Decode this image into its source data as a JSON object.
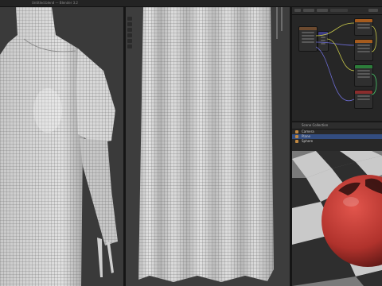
{
  "app": {
    "window_title": "Untitled.blend — Blender 3.2"
  },
  "viewports": {
    "left": {
      "object": "dress-body-mesh"
    },
    "middle": {
      "object": "curtain-mesh"
    }
  },
  "outliner": {
    "header_label": "Scene Collection",
    "items": [
      "Camera",
      "Plane",
      "Sphere"
    ]
  },
  "colors": {
    "viewport_bg": "#3a3a3a",
    "mesh_light": "#d2d2d2",
    "wire": "#5a5a5a",
    "sphere_red": "#b0322c",
    "checker_dark": "#2e2e2e",
    "checker_light": "#c9c9c9",
    "selection_blue": "#334d80"
  }
}
